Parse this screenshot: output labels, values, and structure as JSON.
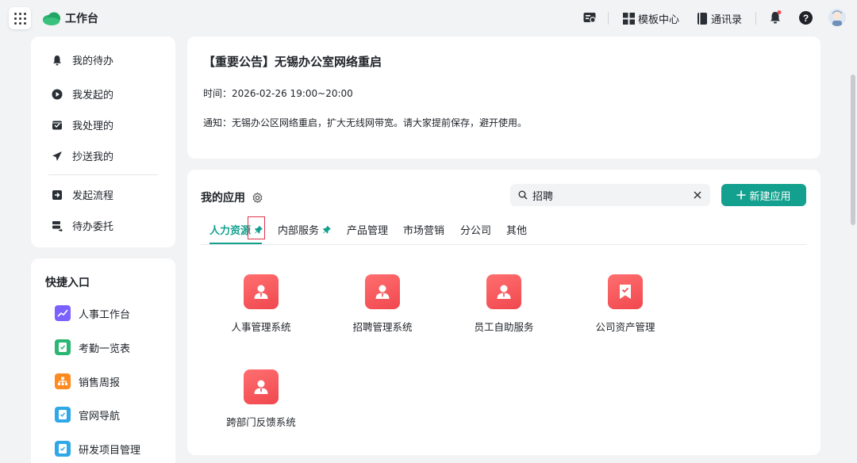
{
  "header": {
    "title": "工作台",
    "template_center": "模板中心",
    "contacts": "通讯录",
    "help": "?"
  },
  "nav": {
    "items": [
      {
        "label": "我的待办",
        "icon": "bell-icon"
      },
      {
        "label": "我发起的",
        "icon": "play-circle-icon"
      },
      {
        "label": "我处理的",
        "icon": "inbox-check-icon"
      },
      {
        "label": "抄送我的",
        "icon": "send-icon"
      },
      {
        "label": "发起流程",
        "icon": "flow-start-icon"
      },
      {
        "label": "待办委托",
        "icon": "delegate-icon"
      }
    ]
  },
  "quick": {
    "title": "快捷入口",
    "items": [
      {
        "label": "人事工作台",
        "icon": "chart-icon",
        "color": "#7b61ff"
      },
      {
        "label": "考勤一览表",
        "icon": "doc-check-icon",
        "color": "#2bb673"
      },
      {
        "label": "销售周报",
        "icon": "org-icon",
        "color": "#ff8a1f"
      },
      {
        "label": "官网导航",
        "icon": "doc-check-icon",
        "color": "#2fa8e8"
      },
      {
        "label": "研发项目管理",
        "icon": "doc-check-icon",
        "color": "#2fa8e8"
      }
    ]
  },
  "notice": {
    "title": "【重要公告】无锡办公室网络重启",
    "time": "时间：2026-02-26 19:00~20:00",
    "body": "通知：无锡办公区网络重启，扩大无线网带宽。请大家提前保存，避开使用。"
  },
  "apps": {
    "title": "我的应用",
    "search_value": "招聘",
    "new_button": "新建应用",
    "tabs": [
      {
        "label": "人力资源",
        "pinned": true,
        "active": true
      },
      {
        "label": "内部服务",
        "pinned": true,
        "active": false
      },
      {
        "label": "产品管理",
        "pinned": false,
        "active": false
      },
      {
        "label": "市场营销",
        "pinned": false,
        "active": false
      },
      {
        "label": "分公司",
        "pinned": false,
        "active": false
      },
      {
        "label": "其他",
        "pinned": false,
        "active": false
      }
    ],
    "tiles": [
      {
        "label": "人事管理系统",
        "icon": "person-icon"
      },
      {
        "label": "招聘管理系统",
        "icon": "person-icon"
      },
      {
        "label": "员工自助服务",
        "icon": "person-icon"
      },
      {
        "label": "公司资产管理",
        "icon": "badge-check-icon"
      },
      {
        "label": "跨部门反馈系统",
        "icon": "person-icon"
      }
    ]
  },
  "colors": {
    "accent": "#14a08e",
    "app_icon": "#f0484f",
    "highlight_box": "#e0324a"
  }
}
